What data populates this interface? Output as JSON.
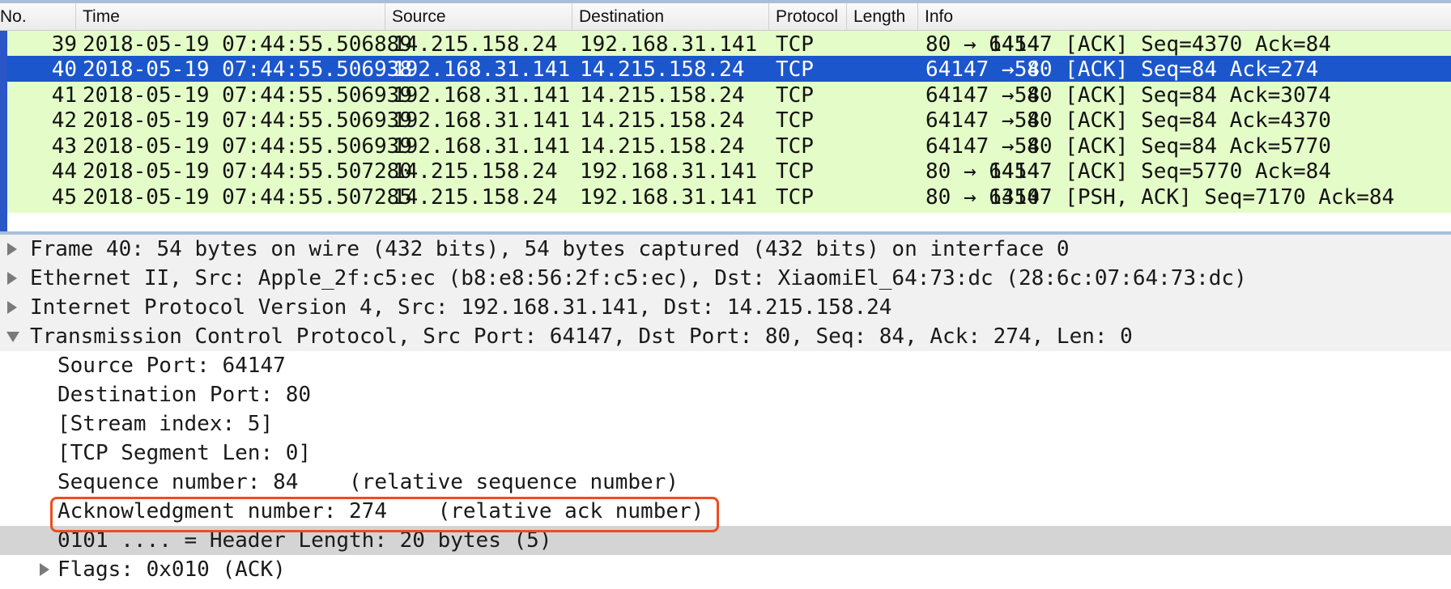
{
  "columns": [
    "No.",
    "Time",
    "Source",
    "Destination",
    "Protocol",
    "Length",
    "Info"
  ],
  "packets": [
    {
      "no": "39",
      "time": "2018-05-19 07:44:55.506889",
      "source": "14.215.158.24",
      "destination": "192.168.31.141",
      "protocol": "TCP",
      "length": "1454",
      "info": "80 → 64147 [ACK] Seq=4370 Ack=84"
    },
    {
      "no": "40",
      "time": "2018-05-19 07:44:55.506938",
      "source": "192.168.31.141",
      "destination": "14.215.158.24",
      "protocol": "TCP",
      "length": "54",
      "info": "64147 → 80 [ACK] Seq=84 Ack=274"
    },
    {
      "no": "41",
      "time": "2018-05-19 07:44:55.506939",
      "source": "192.168.31.141",
      "destination": "14.215.158.24",
      "protocol": "TCP",
      "length": "54",
      "info": "64147 → 80 [ACK] Seq=84 Ack=3074"
    },
    {
      "no": "42",
      "time": "2018-05-19 07:44:55.506939",
      "source": "192.168.31.141",
      "destination": "14.215.158.24",
      "protocol": "TCP",
      "length": "54",
      "info": "64147 → 80 [ACK] Seq=84 Ack=4370"
    },
    {
      "no": "43",
      "time": "2018-05-19 07:44:55.506939",
      "source": "192.168.31.141",
      "destination": "14.215.158.24",
      "protocol": "TCP",
      "length": "54",
      "info": "64147 → 80 [ACK] Seq=84 Ack=5770"
    },
    {
      "no": "44",
      "time": "2018-05-19 07:44:55.507280",
      "source": "14.215.158.24",
      "destination": "192.168.31.141",
      "protocol": "TCP",
      "length": "1454",
      "info": "80 → 64147 [ACK] Seq=5770 Ack=84"
    },
    {
      "no": "45",
      "time": "2018-05-19 07:44:55.507285",
      "source": "14.215.158.24",
      "destination": "192.168.31.141",
      "protocol": "TCP",
      "length": "1350",
      "info": "80 → 64147 [PSH, ACK] Seq=7170 Ack=84"
    }
  ],
  "selected_packet": "40",
  "details": {
    "frame": "Frame 40: 54 bytes on wire (432 bits), 54 bytes captured (432 bits) on interface 0",
    "ethernet": "Ethernet II, Src: Apple_2f:c5:ec (b8:e8:56:2f:c5:ec), Dst: XiaomiEl_64:73:dc (28:6c:07:64:73:dc)",
    "ip": "Internet Protocol Version 4, Src: 192.168.31.141, Dst: 14.215.158.24",
    "tcp": "Transmission Control Protocol, Src Port: 64147, Dst Port: 80, Seq: 84, Ack: 274, Len: 0",
    "tcp_fields": {
      "source_port": "Source Port: 64147",
      "destination_port": "Destination Port: 80",
      "stream_index": "[Stream index: 5]",
      "segment_len": "[TCP Segment Len: 0]",
      "sequence": "Sequence number: 84    (relative sequence number)",
      "ack": "Acknowledgment number: 274    (relative ack number)",
      "header_length": "0101 .... = Header Length: 20 bytes (5)",
      "flags": "Flags: 0x010 (ACK)"
    }
  },
  "colors": {
    "row_bg": "#e4fcc8",
    "selected_bg": "#1b56cc",
    "annotation": "#ee4d1f",
    "highlight_row": "#d4d4d4"
  },
  "icons": {
    "collapsed": "triangle-right-icon",
    "expanded": "triangle-down-icon"
  }
}
